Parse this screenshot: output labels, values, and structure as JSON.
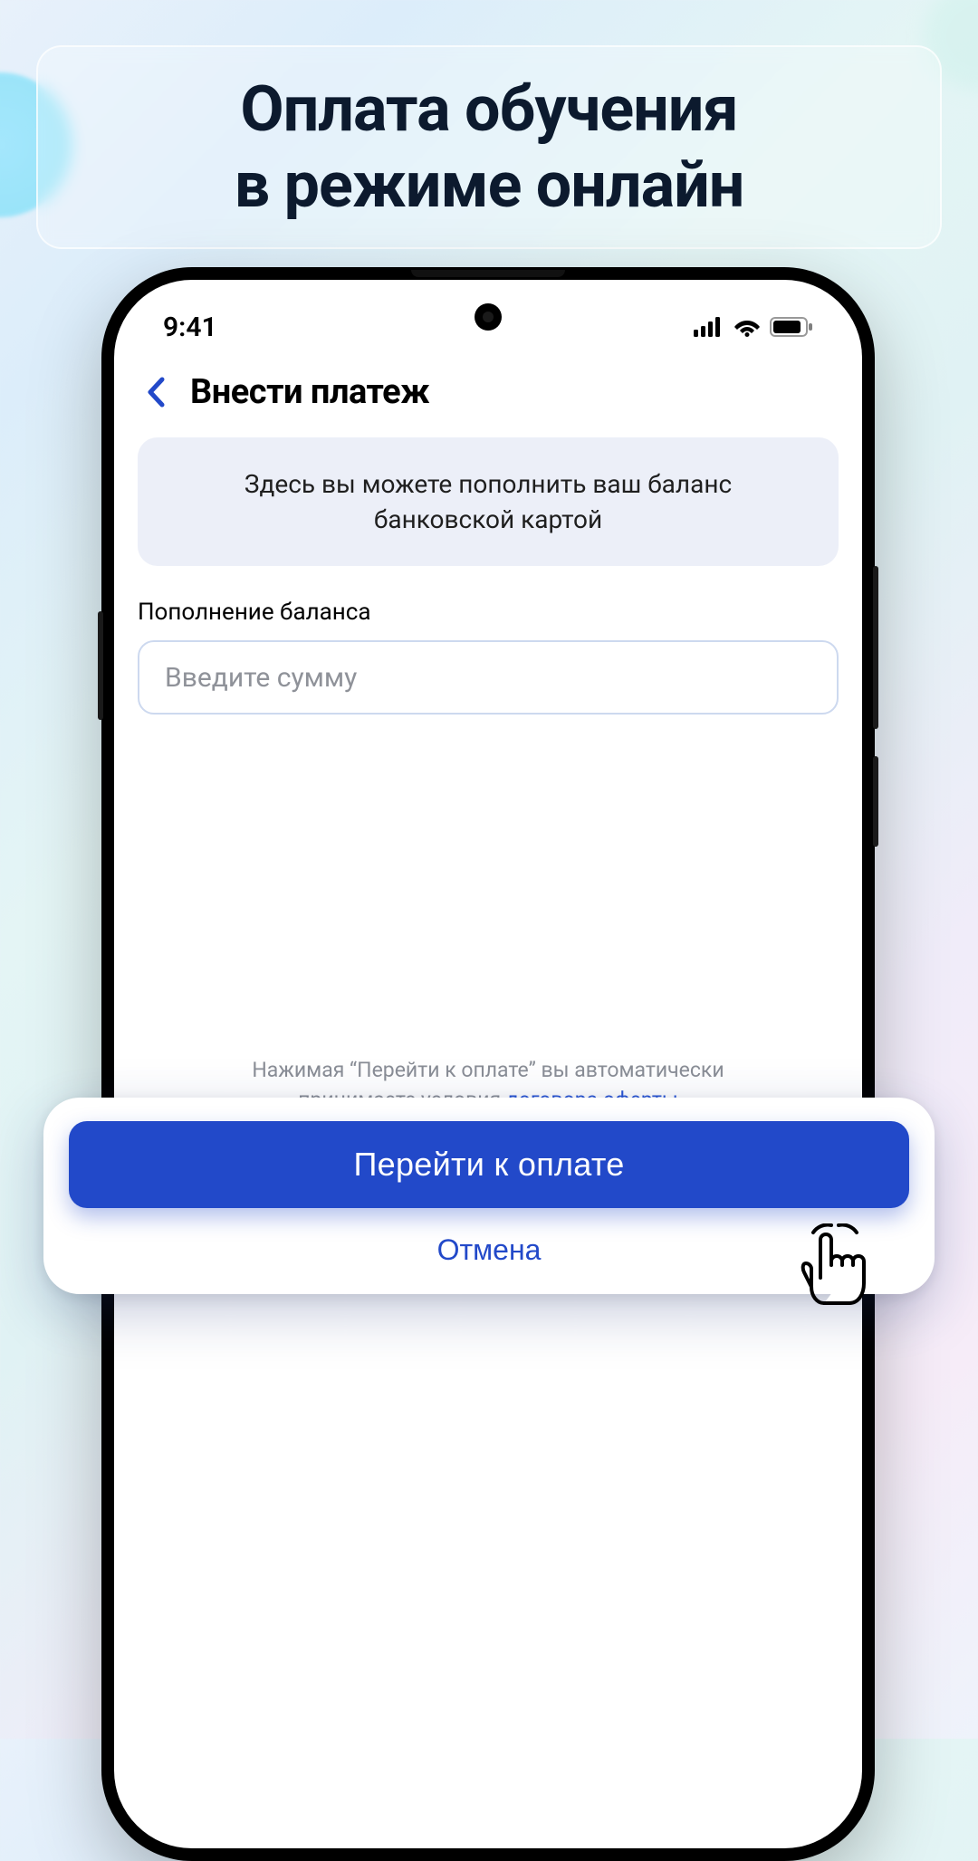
{
  "hero": {
    "title_line1": "Оплата обучения",
    "title_line2": "в режиме онлайн"
  },
  "status": {
    "time": "9:41"
  },
  "nav": {
    "title": "Внести платеж"
  },
  "info": {
    "line1": "Здесь вы можете пополнить ваш баланс",
    "line2": "банковской картой"
  },
  "form": {
    "section_label": "Пополнение баланса",
    "amount_placeholder": "Введите сумму"
  },
  "footer_note": {
    "line1": "Нажимая “Перейти к оплате” вы автоматически",
    "line2_prefix": "принимаете условия ",
    "link": "договора оферты"
  },
  "actions": {
    "primary": "Перейти к оплате",
    "cancel": "Отмена"
  }
}
